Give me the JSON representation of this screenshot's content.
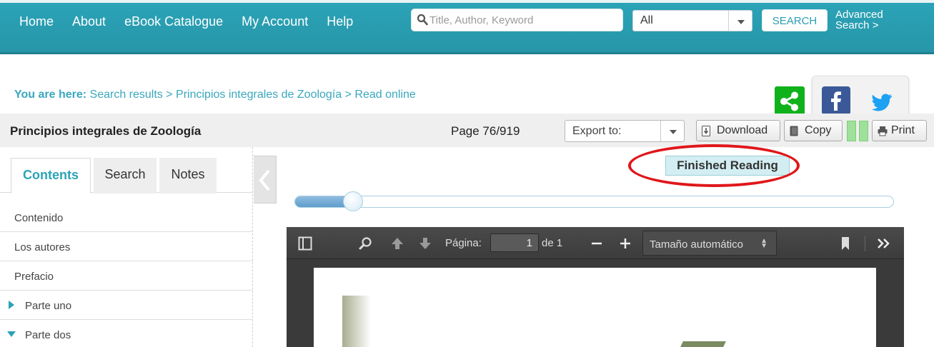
{
  "nav": {
    "items": [
      "Home",
      "About",
      "eBook Catalogue",
      "My Account",
      "Help"
    ],
    "search_placeholder": "Title, Author, Keyword",
    "filter_value": "All",
    "search_button": "SEARCH",
    "advanced_line1": "Advanced",
    "advanced_line2": "Search >"
  },
  "breadcrumb": {
    "prefix": "You are here:",
    "path": "Search results > Principios integrales de Zoología > Read online"
  },
  "toolbar": {
    "book_title": "Principios integrales de Zoología",
    "page_info": "Page 76/919",
    "export_label": "Export to:",
    "download": "Download",
    "copy": "Copy",
    "print": "Print"
  },
  "sidebar": {
    "tabs": [
      "Contents",
      "Search",
      "Notes"
    ],
    "items": [
      {
        "label": "Contenido"
      },
      {
        "label": "Los autores"
      },
      {
        "label": "Prefacio"
      },
      {
        "label": "Parte uno"
      },
      {
        "label": "Parte dos"
      }
    ]
  },
  "reading": {
    "finished_label": "Finished Reading",
    "progress_fraction": 0.097
  },
  "viewer": {
    "page_label": "Página:",
    "page_value": "1",
    "page_total": "de 1",
    "zoom_value": "Tamaño automático"
  },
  "colors": {
    "header": "#2ba3b7",
    "accent": "#3aa7bd",
    "highlight_ring": "#e0161a",
    "share_green": "#10b21b",
    "facebook": "#3b5998",
    "twitter": "#1da1f2"
  }
}
